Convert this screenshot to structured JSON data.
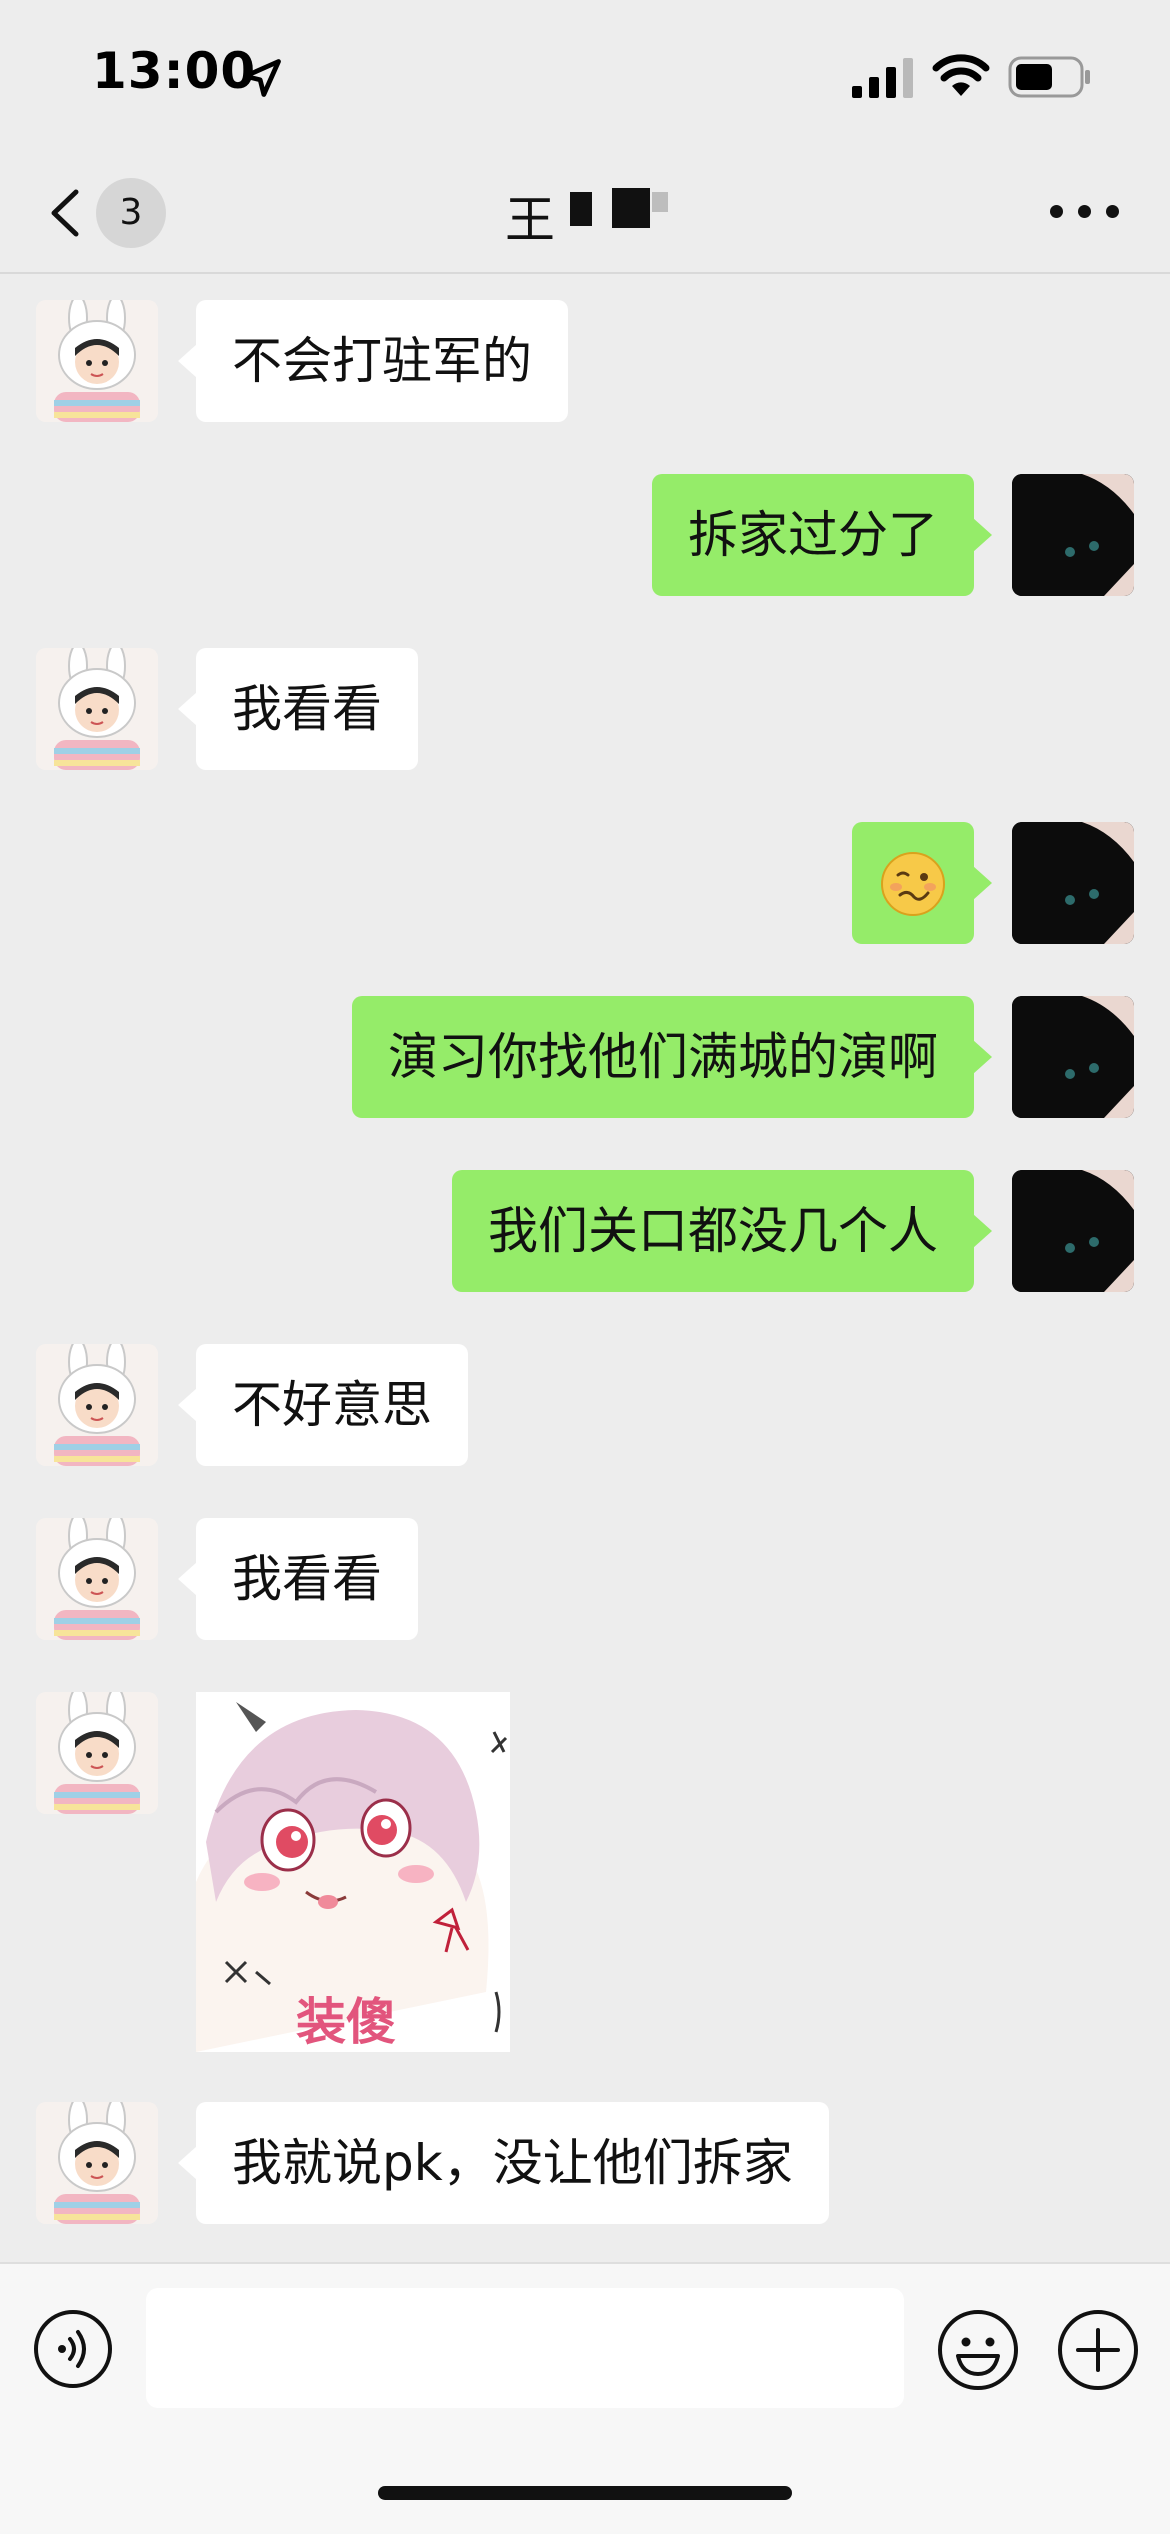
{
  "status_bar": {
    "time": "13:00",
    "icons": [
      "location-arrow-icon",
      "cellular-signal-icon",
      "wifi-icon",
      "battery-icon"
    ]
  },
  "header": {
    "back_icon": "chevron-left-icon",
    "unread_count": "3",
    "title": "王",
    "title_redacted": true,
    "more_icon": "ellipsis-icon"
  },
  "messages": [
    {
      "sender": "them",
      "type": "text",
      "text": "不会打驻军的"
    },
    {
      "sender": "me",
      "type": "text",
      "text": "拆家过分了"
    },
    {
      "sender": "them",
      "type": "text",
      "text": "我看看"
    },
    {
      "sender": "me",
      "type": "emoji",
      "text": "🥴"
    },
    {
      "sender": "me",
      "type": "text",
      "text": "演习你找他们满城的演啊"
    },
    {
      "sender": "me",
      "type": "text",
      "text": "我们关口都没几个人"
    },
    {
      "sender": "them",
      "type": "text",
      "text": "不好意思"
    },
    {
      "sender": "them",
      "type": "text",
      "text": "我看看"
    },
    {
      "sender": "them",
      "type": "sticker",
      "text": "装傻"
    },
    {
      "sender": "them",
      "type": "text",
      "text": "我就说pk，没让他们拆家"
    }
  ],
  "input_bar": {
    "voice_icon": "voice-icon",
    "input_value": "",
    "emoji_icon": "smiley-icon",
    "plus_icon": "plus-circle-icon"
  },
  "colors": {
    "background": "#ededed",
    "my_bubble": "#95ec69",
    "their_bubble": "#ffffff",
    "input_bar": "#f7f7f7"
  }
}
